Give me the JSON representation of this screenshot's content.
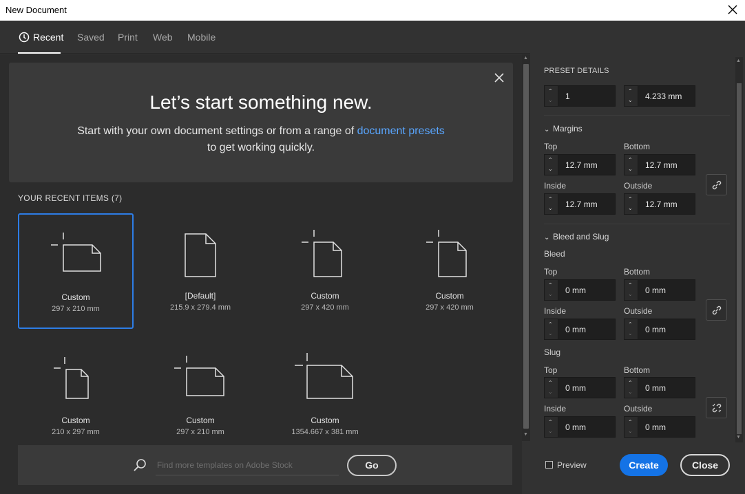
{
  "window": {
    "title": "New Document"
  },
  "tabs": [
    {
      "label": "Recent",
      "icon": "clock-icon",
      "active": true
    },
    {
      "label": "Saved"
    },
    {
      "label": "Print"
    },
    {
      "label": "Web"
    },
    {
      "label": "Mobile"
    }
  ],
  "hero": {
    "heading": "Let’s start something new.",
    "text_before": "Start with your own document settings or from a range of ",
    "link": "document presets",
    "text_after": " to get working quickly."
  },
  "recent": {
    "title": "YOUR RECENT ITEMS  (7)",
    "items": [
      {
        "name": "Custom",
        "size": "297 x 210 mm",
        "icon": "landscape-document-icon",
        "selected": true
      },
      {
        "name": "[Default]",
        "size": "215.9 x 279.4 mm",
        "icon": "letter-document-icon"
      },
      {
        "name": "Custom",
        "size": "297 x 420 mm",
        "icon": "portrait-document-icon"
      },
      {
        "name": "Custom",
        "size": "297 x 420 mm",
        "icon": "portrait-document-icon"
      },
      {
        "name": "Custom",
        "size": "210 x 297 mm",
        "icon": "portrait-document-icon"
      },
      {
        "name": "Custom",
        "size": "297 x 210 mm",
        "icon": "landscape-document-icon"
      },
      {
        "name": "Custom",
        "size": "1354.667 x 381 mm",
        "icon": "wide-document-icon"
      }
    ]
  },
  "search": {
    "placeholder": "Find more templates on Adobe Stock",
    "go_label": "Go"
  },
  "preset": {
    "title": "PRESET DETAILS",
    "top_row": {
      "a": "1",
      "b": "4.233 mm"
    },
    "margins": {
      "label": "Margins",
      "top_label": "Top",
      "bottom_label": "Bottom",
      "inside_label": "Inside",
      "outside_label": "Outside",
      "top": "12.7 mm",
      "bottom": "12.7 mm",
      "inside": "12.7 mm",
      "outside": "12.7 mm"
    },
    "bleed_slug": {
      "label": "Bleed and Slug",
      "bleed_label": "Bleed",
      "slug_label": "Slug",
      "top_label": "Top",
      "bottom_label": "Bottom",
      "inside_label": "Inside",
      "outside_label": "Outside",
      "bleed": {
        "top": "0 mm",
        "bottom": "0 mm",
        "inside": "0 mm",
        "outside": "0 mm"
      },
      "slug": {
        "top": "0 mm",
        "bottom": "0 mm",
        "inside": "0 mm",
        "outside": "0 mm"
      }
    }
  },
  "footer": {
    "preview_label": "Preview",
    "create_label": "Create",
    "close_label": "Close"
  },
  "colors": {
    "accent": "#1473e6",
    "selection": "#2d7de6",
    "link": "#59a6ff",
    "panel": "#323232",
    "background": "#2c2c2c"
  }
}
